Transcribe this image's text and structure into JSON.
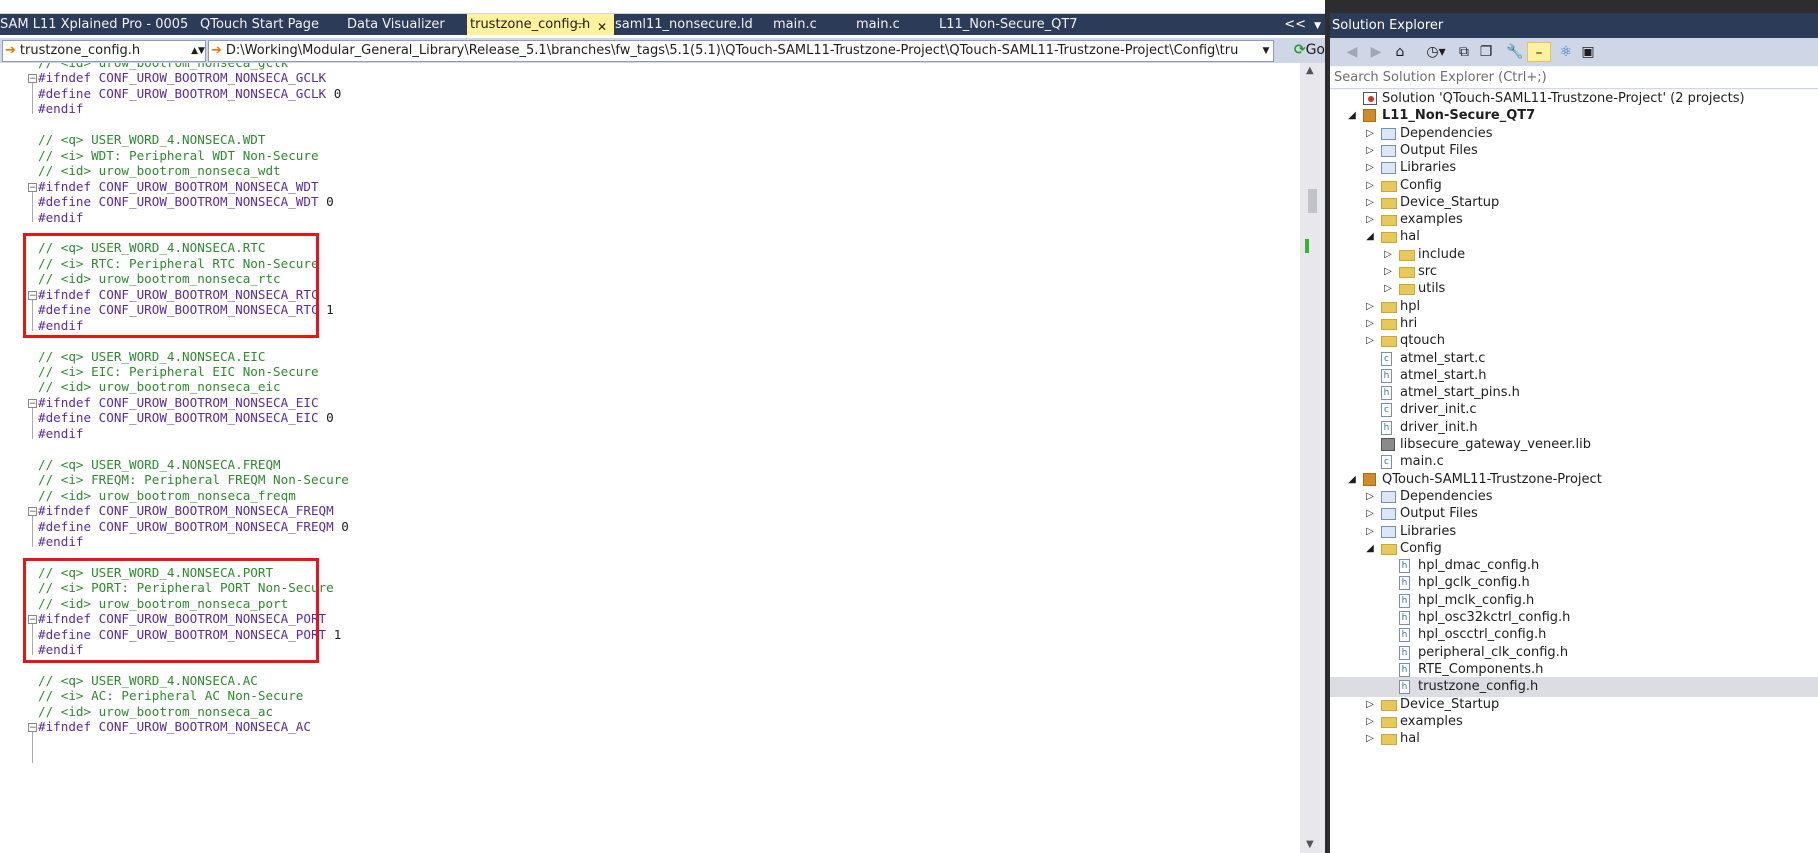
{
  "tabs": [
    {
      "label": "SAM L11 Xplained Pro - 0005",
      "active": false
    },
    {
      "label": "QTouch Start Page",
      "active": false
    },
    {
      "label": "Data Visualizer",
      "active": false
    },
    {
      "label": "trustzone_config.h",
      "active": true
    },
    {
      "label": "saml11_nonsecure.ld",
      "active": false
    },
    {
      "label": "main.c",
      "active": false
    },
    {
      "label": "main.c",
      "active": false
    },
    {
      "label": "L11_Non-Secure_QT7",
      "active": false
    }
  ],
  "tab_overflow_glyph": "<<",
  "tab_dropdown_glyph": "▼",
  "tab_pin_glyph": "⊣",
  "tab_close_glyph": "✕",
  "navbar": {
    "file_combo": "trustzone_config.h",
    "path_combo": "D:\\Working\\Modular_General_Library\\Release_5.1\\branches\\fw_tags\\5.1(5.1)\\QTouch-SAML11-Trustzone-Project\\QTouch-SAML11-Trustzone-Project\\Config\\tru",
    "go_label": "Go"
  },
  "code_lines": [
    {
      "text": "// <id> urow_bootrom_nonseca_gclk",
      "kind": "comment"
    },
    {
      "text": "#ifndef CONF_UROW_BOOTROM_NONSECA_GCLK",
      "kind": "pre"
    },
    {
      "text": "#define CONF_UROW_BOOTROM_NONSECA_GCLK ",
      "kind": "pre",
      "num": "0"
    },
    {
      "text": "#endif",
      "kind": "pre"
    },
    {
      "text": "",
      "kind": "blank"
    },
    {
      "text": "// <q> USER_WORD_4.NONSECA.WDT",
      "kind": "comment"
    },
    {
      "text": "// <i> WDT: Peripheral WDT Non-Secure",
      "kind": "comment"
    },
    {
      "text": "// <id> urow_bootrom_nonseca_wdt",
      "kind": "comment"
    },
    {
      "text": "#ifndef CONF_UROW_BOOTROM_NONSECA_WDT",
      "kind": "pre"
    },
    {
      "text": "#define CONF_UROW_BOOTROM_NONSECA_WDT ",
      "kind": "pre",
      "num": "0"
    },
    {
      "text": "#endif",
      "kind": "pre"
    },
    {
      "text": "",
      "kind": "blank"
    },
    {
      "text": "// <q> USER_WORD_4.NONSECA.RTC",
      "kind": "comment"
    },
    {
      "text": "// <i> RTC: Peripheral RTC Non-Secure",
      "kind": "comment"
    },
    {
      "text": "// <id> urow_bootrom_nonseca_rtc",
      "kind": "comment"
    },
    {
      "text": "#ifndef CONF_UROW_BOOTROM_NONSECA_RTC",
      "kind": "pre"
    },
    {
      "text": "#define CONF_UROW_BOOTROM_NONSECA_RTC ",
      "kind": "pre",
      "num": "1"
    },
    {
      "text": "#endif",
      "kind": "pre"
    },
    {
      "text": "",
      "kind": "blank"
    },
    {
      "text": "// <q> USER_WORD_4.NONSECA.EIC",
      "kind": "comment"
    },
    {
      "text": "// <i> EIC: Peripheral EIC Non-Secure",
      "kind": "comment"
    },
    {
      "text": "// <id> urow_bootrom_nonseca_eic",
      "kind": "comment"
    },
    {
      "text": "#ifndef CONF_UROW_BOOTROM_NONSECA_EIC",
      "kind": "pre"
    },
    {
      "text": "#define CONF_UROW_BOOTROM_NONSECA_EIC ",
      "kind": "pre",
      "num": "0"
    },
    {
      "text": "#endif",
      "kind": "pre"
    },
    {
      "text": "",
      "kind": "blank"
    },
    {
      "text": "// <q> USER_WORD_4.NONSECA.FREQM",
      "kind": "comment"
    },
    {
      "text": "// <i> FREQM: Peripheral FREQM Non-Secure",
      "kind": "comment"
    },
    {
      "text": "// <id> urow_bootrom_nonseca_freqm",
      "kind": "comment"
    },
    {
      "text": "#ifndef CONF_UROW_BOOTROM_NONSECA_FREQM",
      "kind": "pre"
    },
    {
      "text": "#define CONF_UROW_BOOTROM_NONSECA_FREQM ",
      "kind": "pre",
      "num": "0"
    },
    {
      "text": "#endif",
      "kind": "pre"
    },
    {
      "text": "",
      "kind": "blank"
    },
    {
      "text": "// <q> USER_WORD_4.NONSECA.PORT",
      "kind": "comment"
    },
    {
      "text": "// <i> PORT: Peripheral PORT Non-Secure",
      "kind": "comment"
    },
    {
      "text": "// <id> urow_bootrom_nonseca_port",
      "kind": "comment"
    },
    {
      "text": "#ifndef CONF_UROW_BOOTROM_NONSECA_PORT",
      "kind": "pre"
    },
    {
      "text": "#define CONF_UROW_BOOTROM_NONSECA_PORT ",
      "kind": "pre",
      "num": "1"
    },
    {
      "text": "#endif",
      "kind": "pre"
    },
    {
      "text": "",
      "kind": "blank"
    },
    {
      "text": "// <q> USER_WORD_4.NONSECA.AC",
      "kind": "comment"
    },
    {
      "text": "// <i> AC: Peripheral AC Non-Secure",
      "kind": "comment"
    },
    {
      "text": "// <id> urow_bootrom_nonseca_ac",
      "kind": "comment"
    },
    {
      "text": "#ifndef CONF_UROW_BOOTROM_NONSECA_AC",
      "kind": "pre"
    }
  ],
  "highlights": [
    {
      "label": "rtc-highlight",
      "first_line": 12,
      "last_line": 17
    },
    {
      "label": "port-highlight",
      "first_line": 33,
      "last_line": 38
    }
  ],
  "colors": {
    "comment": "#2e8b2e",
    "preprocessor": "#5a2ca0",
    "highlight_box": "#e8141a",
    "active_tab": "#fff29d",
    "title_bar": "#2b3b58"
  },
  "solution_explorer": {
    "title": "Solution Explorer",
    "search_placeholder": "Search Solution Explorer (Ctrl+;)",
    "tree": [
      {
        "label": "Solution 'QTouch-SAML11-Trustzone-Project' (2 projects)",
        "depth": 0,
        "icon": "solution-icon",
        "exp": ""
      },
      {
        "label": "L11_Non-Secure_QT7",
        "depth": 0,
        "icon": "project-icon",
        "exp": "open",
        "bold": true
      },
      {
        "label": "Dependencies",
        "depth": 1,
        "icon": "references-icon",
        "exp": "closed"
      },
      {
        "label": "Output Files",
        "depth": 1,
        "icon": "references-icon",
        "exp": "closed"
      },
      {
        "label": "Libraries",
        "depth": 1,
        "icon": "library-icon",
        "exp": "closed"
      },
      {
        "label": "Config",
        "depth": 1,
        "icon": "folder-icon",
        "exp": "closed"
      },
      {
        "label": "Device_Startup",
        "depth": 1,
        "icon": "folder-icon",
        "exp": "closed"
      },
      {
        "label": "examples",
        "depth": 1,
        "icon": "folder-icon",
        "exp": "closed"
      },
      {
        "label": "hal",
        "depth": 1,
        "icon": "folder-open-icon",
        "exp": "open"
      },
      {
        "label": "include",
        "depth": 2,
        "icon": "folder-icon",
        "exp": "closed"
      },
      {
        "label": "src",
        "depth": 2,
        "icon": "folder-icon",
        "exp": "closed"
      },
      {
        "label": "utils",
        "depth": 2,
        "icon": "folder-icon",
        "exp": "closed"
      },
      {
        "label": "hpl",
        "depth": 1,
        "icon": "folder-icon",
        "exp": "closed"
      },
      {
        "label": "hri",
        "depth": 1,
        "icon": "folder-icon",
        "exp": "closed"
      },
      {
        "label": "qtouch",
        "depth": 1,
        "icon": "folder-icon",
        "exp": "closed"
      },
      {
        "label": "atmel_start.c",
        "depth": 1,
        "icon": "c-file-icon",
        "exp": ""
      },
      {
        "label": "atmel_start.h",
        "depth": 1,
        "icon": "h-file-icon",
        "exp": ""
      },
      {
        "label": "atmel_start_pins.h",
        "depth": 1,
        "icon": "h-file-icon",
        "exp": ""
      },
      {
        "label": "driver_init.c",
        "depth": 1,
        "icon": "c-file-icon",
        "exp": ""
      },
      {
        "label": "driver_init.h",
        "depth": 1,
        "icon": "h-file-icon",
        "exp": ""
      },
      {
        "label": "libsecure_gateway_veneer.lib",
        "depth": 1,
        "icon": "lib-file-icon",
        "exp": ""
      },
      {
        "label": "main.c",
        "depth": 1,
        "icon": "c-file-icon",
        "exp": ""
      },
      {
        "label": "QTouch-SAML11-Trustzone-Project",
        "depth": 0,
        "icon": "project-icon",
        "exp": "open"
      },
      {
        "label": "Dependencies",
        "depth": 1,
        "icon": "references-icon",
        "exp": "closed"
      },
      {
        "label": "Output Files",
        "depth": 1,
        "icon": "references-icon",
        "exp": "closed"
      },
      {
        "label": "Libraries",
        "depth": 1,
        "icon": "library-icon",
        "exp": "closed"
      },
      {
        "label": "Config",
        "depth": 1,
        "icon": "folder-open-icon",
        "exp": "open"
      },
      {
        "label": "hpl_dmac_config.h",
        "depth": 2,
        "icon": "h-file-icon",
        "exp": ""
      },
      {
        "label": "hpl_gclk_config.h",
        "depth": 2,
        "icon": "h-file-icon",
        "exp": ""
      },
      {
        "label": "hpl_mclk_config.h",
        "depth": 2,
        "icon": "h-file-icon",
        "exp": ""
      },
      {
        "label": "hpl_osc32kctrl_config.h",
        "depth": 2,
        "icon": "h-file-icon",
        "exp": ""
      },
      {
        "label": "hpl_oscctrl_config.h",
        "depth": 2,
        "icon": "h-file-icon",
        "exp": ""
      },
      {
        "label": "peripheral_clk_config.h",
        "depth": 2,
        "icon": "h-file-icon",
        "exp": ""
      },
      {
        "label": "RTE_Components.h",
        "depth": 2,
        "icon": "h-file-icon",
        "exp": ""
      },
      {
        "label": "trustzone_config.h",
        "depth": 2,
        "icon": "h-file-icon",
        "exp": "",
        "selected": true
      },
      {
        "label": "Device_Startup",
        "depth": 1,
        "icon": "folder-icon",
        "exp": "closed"
      },
      {
        "label": "examples",
        "depth": 1,
        "icon": "folder-icon",
        "exp": "closed"
      },
      {
        "label": "hal",
        "depth": 1,
        "icon": "folder-icon",
        "exp": "closed"
      }
    ]
  }
}
